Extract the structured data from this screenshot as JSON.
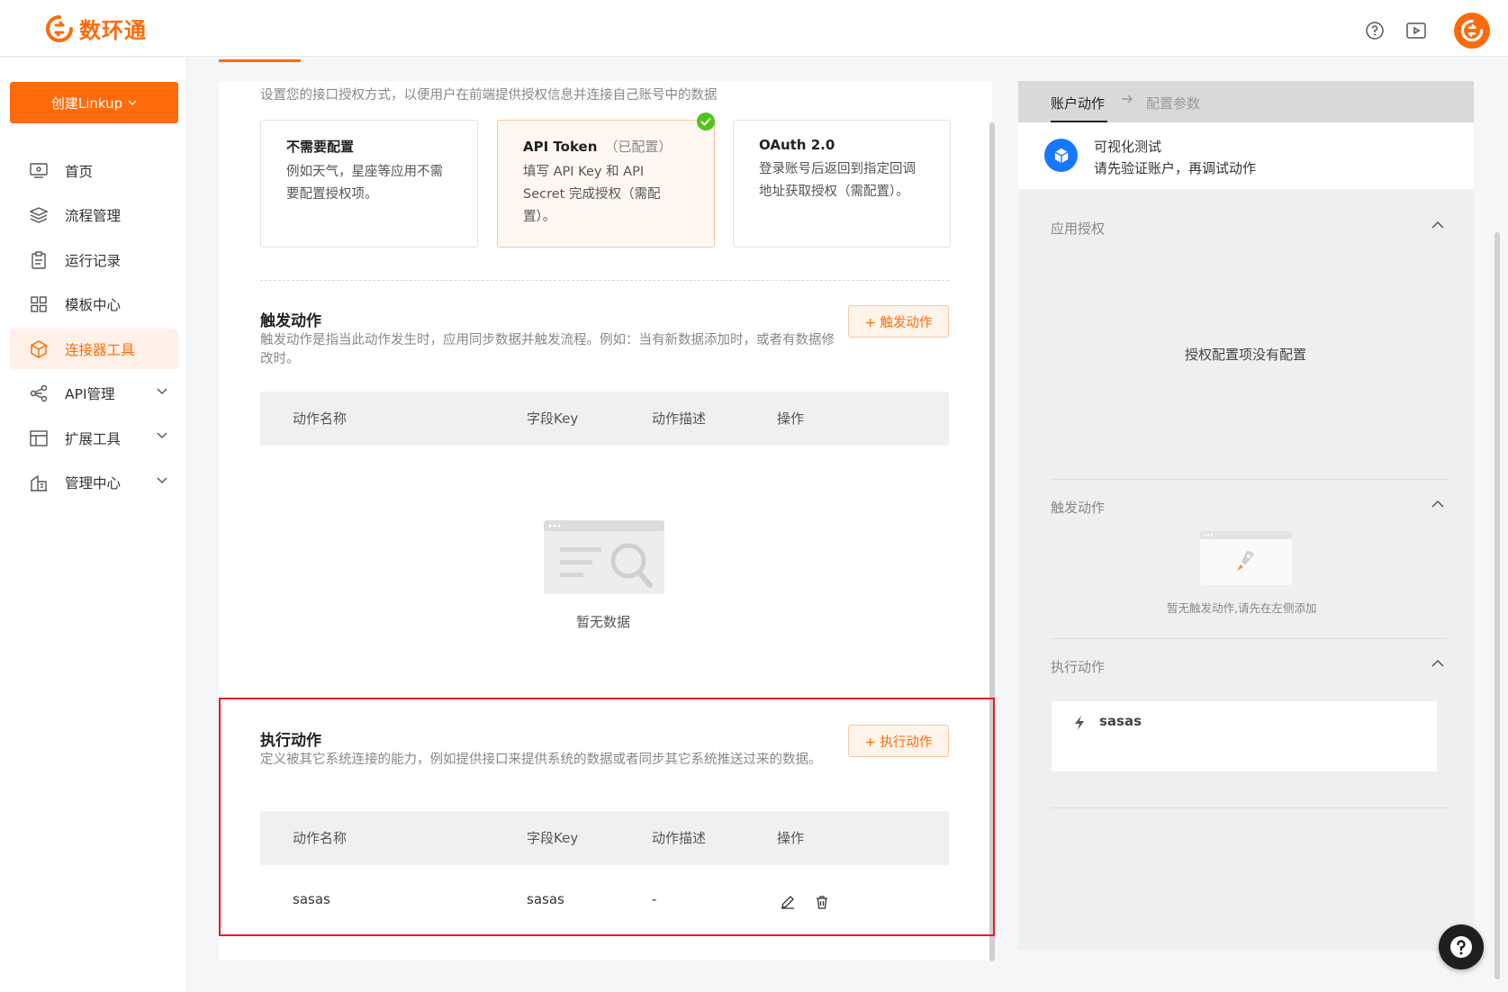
{
  "header": {
    "brand": "数环通",
    "icons": [
      "help-circle-icon",
      "video-play-icon"
    ],
    "brand_color": "#ff6a0a"
  },
  "sidebar": {
    "create_button": "创建Linkup",
    "items": [
      {
        "label": "首页",
        "icon": "monitor-icon"
      },
      {
        "label": "流程管理",
        "icon": "layers-icon"
      },
      {
        "label": "运行记录",
        "icon": "clipboard-icon"
      },
      {
        "label": "模板中心",
        "icon": "grid-icon"
      },
      {
        "label": "连接器工具",
        "icon": "cube-icon",
        "active": true
      },
      {
        "label": "API管理",
        "icon": "api-icon",
        "expandable": true
      },
      {
        "label": "扩展工具",
        "icon": "layout-icon",
        "expandable": true
      },
      {
        "label": "管理中心",
        "icon": "building-icon",
        "expandable": true
      }
    ]
  },
  "auth": {
    "subtitle": "设置您的接口授权方式，以便用户在前端提供授权信息并连接自己账号中的数据",
    "options": [
      {
        "title": "不需要配置",
        "sub": "",
        "desc": "例如天气，星座等应用不需要配置授权项。"
      },
      {
        "title": "API Token",
        "sub": "（已配置）",
        "desc": "填写 API Key 和 API Secret 完成授权（需配置）。",
        "selected": true
      },
      {
        "title": "OAuth 2.0",
        "sub": "",
        "desc": "登录账号后返回到指定回调地址获取授权（需配置）。"
      }
    ]
  },
  "trigger": {
    "title": "触发动作",
    "desc": "触发动作是指当此动作发生时，应用同步数据并触发流程。例如：当有新数据添加时，或者有数据修改时。",
    "add_button": "+ 触发动作",
    "columns": [
      "动作名称",
      "字段Key",
      "动作描述",
      "操作"
    ],
    "empty_text": "暂无数据"
  },
  "execute": {
    "title": "执行动作",
    "desc": "定义被其它系统连接的能力，例如提供接口来提供系统的数据或者同步其它系统推送过来的数据。",
    "add_button": "+ 执行动作",
    "columns": [
      "动作名称",
      "字段Key",
      "动作描述",
      "操作"
    ],
    "rows": [
      {
        "name": "sasas",
        "key": "sasas",
        "desc": "-"
      }
    ]
  },
  "right_panel": {
    "tabs": [
      "账户动作",
      "配置参数"
    ],
    "test_title": "可视化测试",
    "test_sub": "请先验证账户，再调试动作",
    "app_auth": {
      "title": "应用授权",
      "empty": "授权配置项没有配置"
    },
    "trigger": {
      "title": "触发动作",
      "empty": "暂无触发动作,请先在左侧添加"
    },
    "execute": {
      "title": "执行动作",
      "items": [
        "sasas"
      ]
    }
  }
}
